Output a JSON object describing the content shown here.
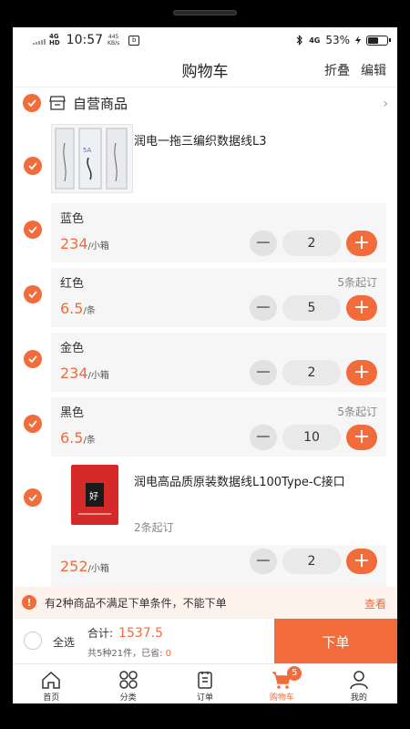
{
  "status_bar": {
    "network": "4G",
    "network2": "HD",
    "time": "10:57",
    "speed_value": "445",
    "speed_unit": "KB/s",
    "carrier_badge": "b",
    "right_network": "4G",
    "battery": "53%",
    "battery_level": 0.53
  },
  "header": {
    "title": "购物车",
    "fold_label": "折叠",
    "edit_label": "编辑"
  },
  "store": {
    "name": "自营商品",
    "icon": "store-icon"
  },
  "products": [
    {
      "name": "润电一拖三编织数据线L3",
      "thumb_text": "5A",
      "variants": [
        {
          "name": "蓝色",
          "min_order": "",
          "price": "234",
          "unit": "/小箱",
          "qty": "2"
        },
        {
          "name": "红色",
          "min_order": "5条起订",
          "price": "6.5",
          "unit": "/条",
          "qty": "5"
        },
        {
          "name": "金色",
          "min_order": "",
          "price": "234",
          "unit": "/小箱",
          "qty": "2"
        },
        {
          "name": "黑色",
          "min_order": "5条起订",
          "price": "6.5",
          "unit": "/条",
          "qty": "10"
        }
      ]
    },
    {
      "name": "润电高品质原装数据线L100Type-C接口",
      "thumb_text": "好",
      "min_order": "2条起订",
      "variants": [
        {
          "name": "",
          "min_order": "",
          "price": "252",
          "unit": "/小箱",
          "qty": "2"
        }
      ]
    }
  ],
  "notice": {
    "text": "有2种商品不满足下单条件，不能下单",
    "link": "查看"
  },
  "checkout": {
    "select_all": "全选",
    "total_label": "合计:",
    "total": "1537.5",
    "summary_prefix": "共5种21件，已省:",
    "saved": "0",
    "order_button": "下单"
  },
  "tabbar": [
    {
      "label": "首页",
      "icon": "home-icon"
    },
    {
      "label": "分类",
      "icon": "category-icon"
    },
    {
      "label": "订单",
      "icon": "order-icon"
    },
    {
      "label": "购物车",
      "icon": "cart-icon",
      "badge": "5",
      "active": true
    },
    {
      "label": "我的",
      "icon": "profile-icon"
    }
  ],
  "colors": {
    "accent": "#f26b3a",
    "background": "#f2f2f2"
  }
}
